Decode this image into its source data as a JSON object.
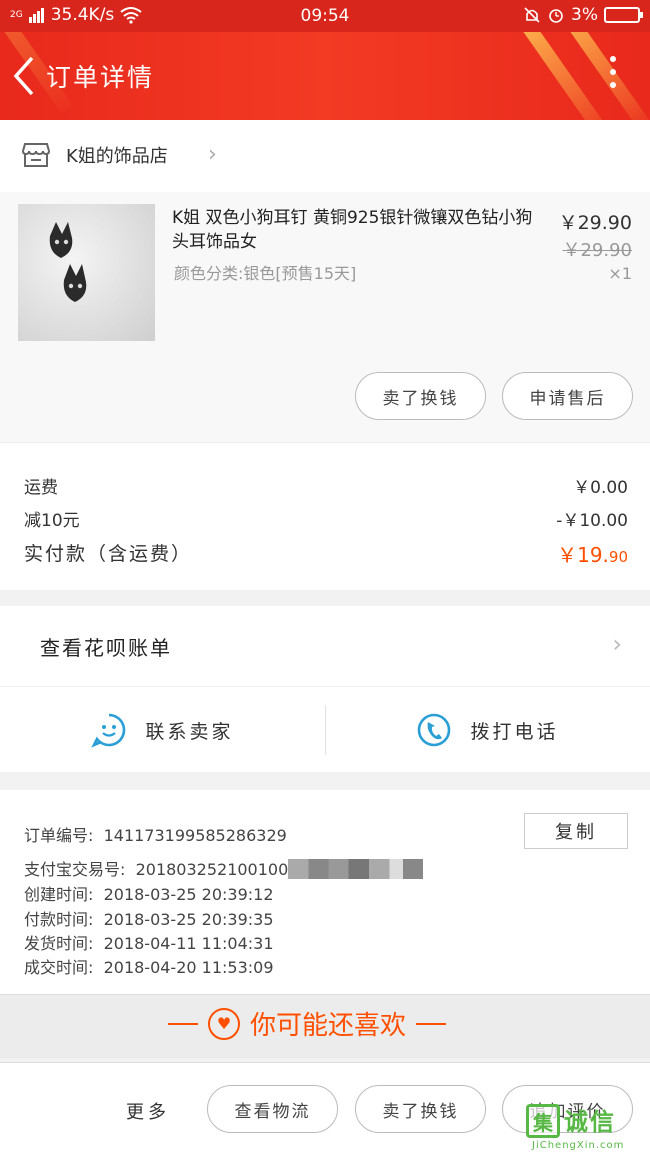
{
  "status_bar": {
    "signal": "2G",
    "speed": "35.4K/s",
    "time": "09:54",
    "battery": "3%"
  },
  "header": {
    "title": "订单详情"
  },
  "shop": {
    "name": "K姐的饰品店"
  },
  "product": {
    "name": "K姐 双色小狗耳钉 黄铜925银针微镶双色钻小狗头耳饰品女",
    "spec": "颜色分类:银色[预售15天]",
    "price": "￥29.90",
    "original_price": "￥29.90",
    "quantity": "×1",
    "actions": [
      "卖了换钱",
      "申请售后"
    ]
  },
  "cost": {
    "shipping_label": "运费",
    "shipping_value": "￥0.00",
    "discount_label": "减10元",
    "discount_value": "-￥10.00",
    "total_label": "实付款（含运费）",
    "total_value_main": "￥19.",
    "total_value_cents": "90"
  },
  "huabei": {
    "label": "查看花呗账单"
  },
  "contact": {
    "seller_label": "联系卖家",
    "phone_label": "拨打电话"
  },
  "order_info": {
    "order_no_label": "订单编号:",
    "order_no": "141173199585286329",
    "copy_label": "复制",
    "alipay_label": "支付宝交易号:",
    "alipay_no": "201803252100100",
    "created_label": "创建时间:",
    "created": "2018-03-25 20:39:12",
    "paid_label": "付款时间:",
    "paid": "2018-03-25 20:39:35",
    "shipped_label": "发货时间:",
    "shipped": "2018-04-11 11:04:31",
    "completed_label": "成交时间:",
    "completed": "2018-04-20 11:53:09"
  },
  "recommend": {
    "title": "你可能还喜欢"
  },
  "bottom_bar": {
    "more_label": "更多",
    "buttons": [
      "查看物流",
      "卖了换钱",
      "追加评价"
    ]
  },
  "watermark": {
    "box": "集",
    "text": "诚信",
    "url": "JiChengXin.com"
  },
  "colors": {
    "header_red": "#e8291c",
    "price_orange": "#ff5000",
    "accent_blue": "#2a9fd6"
  }
}
